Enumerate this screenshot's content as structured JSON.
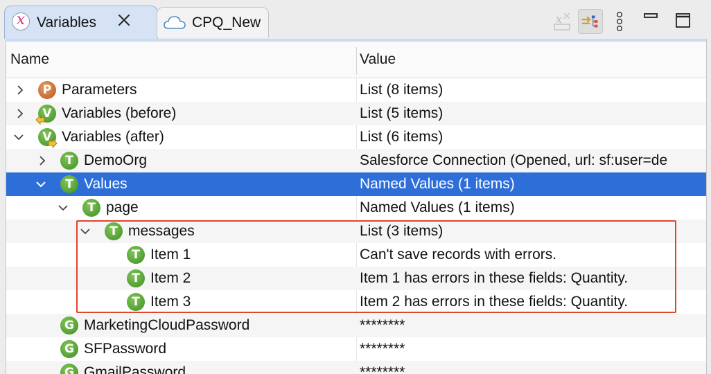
{
  "tabs": {
    "active": {
      "label": "Variables",
      "icon": "variables-x-icon"
    },
    "inactive": {
      "label": "CPQ_New",
      "icon": "cloud-icon"
    }
  },
  "toolbar": {
    "icons": [
      "clear-variables-icon",
      "collapse-tree-icon",
      "vertical-ellipsis-icon",
      "minimize-icon",
      "maximize-icon"
    ]
  },
  "columns": {
    "name": "Name",
    "value": "Value"
  },
  "rows": [
    {
      "name": "Parameters",
      "value": "List (8 items)"
    },
    {
      "name": "Variables (before)",
      "value": "List (5 items)"
    },
    {
      "name": "Variables (after)",
      "value": "List (6 items)"
    },
    {
      "name": "DemoOrg",
      "value": "Salesforce Connection (Opened, url: sf:user=de"
    },
    {
      "name": "Values",
      "value": "Named Values (1 items)"
    },
    {
      "name": "page",
      "value": "Named Values (1 items)"
    },
    {
      "name": "messages",
      "value": "List (3 items)"
    },
    {
      "name": "Item 1",
      "value": "Can't save records with errors."
    },
    {
      "name": "Item 2",
      "value": "Item 1 has errors in these fields: Quantity."
    },
    {
      "name": "Item 3",
      "value": "Item 2 has errors in these fields: Quantity."
    },
    {
      "name": "MarketingCloudPassword",
      "value": "********"
    },
    {
      "name": "SFPassword",
      "value": "********"
    },
    {
      "name": "GmailPassword",
      "value": "********"
    }
  ],
  "icon_letters": {
    "p": "P",
    "v": "V",
    "t": "T",
    "g": "G"
  },
  "colors": {
    "selection": "#2e6ed8",
    "highlight_border": "#e0452e",
    "type_icon_green": "#3e8e22",
    "param_icon_orange": "#b8571c"
  }
}
